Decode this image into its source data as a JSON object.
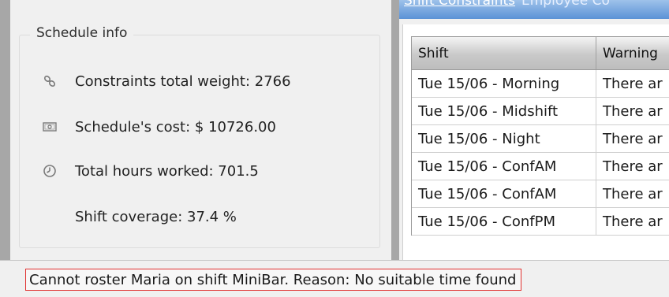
{
  "tabs": {
    "active_label": "Shift Constraints",
    "inactive_label": "Employee Co"
  },
  "schedule_info": {
    "title": "Schedule info",
    "rows": [
      {
        "icon": "chain-link-icon",
        "text": "Constraints total weight: 2766"
      },
      {
        "icon": "banknote-icon",
        "text": "Schedule's cost: $ 10726.00"
      },
      {
        "icon": "clock-icon",
        "text": "Total hours worked: 701.5"
      },
      {
        "icon": "",
        "text": "Shift coverage: 37.4 %"
      }
    ]
  },
  "table": {
    "columns": [
      "Shift",
      "Warning"
    ],
    "rows": [
      {
        "shift": "Tue 15/06 - Morning",
        "warning": "There ar"
      },
      {
        "shift": "Tue 15/06 - Midshift",
        "warning": "There ar"
      },
      {
        "shift": "Tue 15/06 - Night",
        "warning": "There ar"
      },
      {
        "shift": "Tue 15/06 - ConfAM",
        "warning": "There ar"
      },
      {
        "shift": "Tue 15/06 - ConfAM",
        "warning": "There ar"
      },
      {
        "shift": "Tue 15/06 - ConfPM",
        "warning": "There ar"
      }
    ]
  },
  "status": {
    "message": "Cannot roster Maria on shift MiniBar. Reason: No suitable time found"
  },
  "colors": {
    "tab_accent": "#5b92d6",
    "error_border": "#e0302f"
  }
}
